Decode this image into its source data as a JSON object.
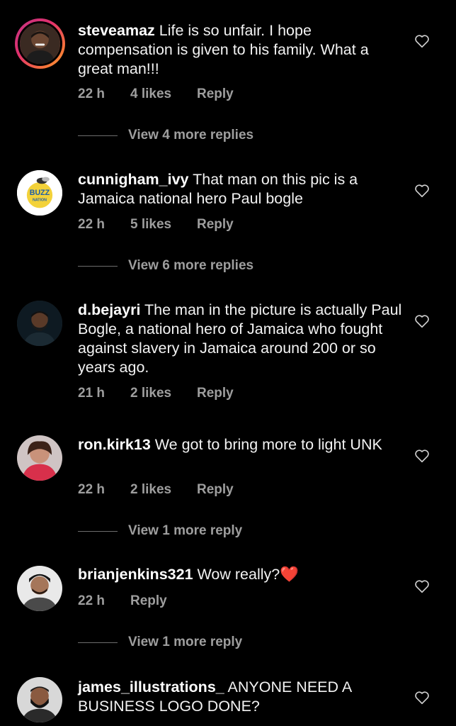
{
  "comments": [
    {
      "username": "steveamaz",
      "text": "Life is so unfair. I hope compensation is given to his family.  What a great man!!!",
      "time": "22 h",
      "likes": "4 likes",
      "reply": "Reply",
      "view_replies": "View 4 more replies"
    },
    {
      "username": "cunnigham_ivy",
      "text": "That man on this pic is a Jamaica national hero Paul bogle",
      "time": "22 h",
      "likes": "5 likes",
      "reply": "Reply",
      "view_replies": "View 6 more replies",
      "avatar_text": "BUZZ NATION"
    },
    {
      "username": "d.bejayri",
      "text": "The man in the picture is actually Paul Bogle, a national hero of Jamaica who fought against slavery in Jamaica around 200 or so years ago.",
      "time": "21 h",
      "likes": "2 likes",
      "reply": "Reply"
    },
    {
      "username": "ron.kirk13",
      "text": "We got to bring more to light UNK",
      "time": "22 h",
      "likes": "2 likes",
      "reply": "Reply",
      "view_replies": "View 1 more reply"
    },
    {
      "username": "brianjenkins321",
      "text": "Wow really?",
      "emoji": "❤️",
      "time": "22 h",
      "reply": "Reply",
      "view_replies": "View 1 more reply"
    },
    {
      "username": "james_illustrations_",
      "text": "ANYONE NEED A BUSINESS LOGO DONE?"
    }
  ],
  "icons": {
    "like": "heart-outline-icon"
  },
  "colors": {
    "background": "#000000",
    "text": "#f2f2f2",
    "muted": "#9e9e9e",
    "emoji_red": "#e0245e"
  }
}
